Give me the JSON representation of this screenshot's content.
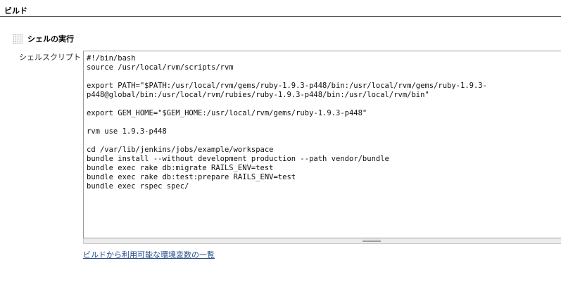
{
  "section": {
    "title": "ビルド"
  },
  "build_step": {
    "title": "シェルの実行",
    "handle_icon": "drag-handle-icon"
  },
  "shell_script": {
    "label": "シェルスクリプト",
    "value": "#!/bin/bash\nsource /usr/local/rvm/scripts/rvm\n\nexport PATH=\"$PATH:/usr/local/rvm/gems/ruby-1.9.3-p448/bin:/usr/local/rvm/gems/ruby-1.9.3-\np448@global/bin:/usr/local/rvm/rubies/ruby-1.9.3-p448/bin:/usr/local/rvm/bin\"\n\nexport GEM_HOME=\"$GEM_HOME:/usr/local/rvm/gems/ruby-1.9.3-p448\"\n\nrvm use 1.9.3-p448\n\ncd /var/lib/jenkins/jobs/example/workspace\nbundle install --without development production --path vendor/bundle\nbundle exec rake db:migrate RAILS_ENV=test\nbundle exec rake db:test:prepare RAILS_ENV=test\nbundle exec rspec spec/"
  },
  "links": {
    "env_vars": "ビルドから利用可能な環境変数の一覧"
  },
  "colors": {
    "link": "#204a87",
    "header_rule": "#555555",
    "textarea_border": "#9a9a9a"
  }
}
